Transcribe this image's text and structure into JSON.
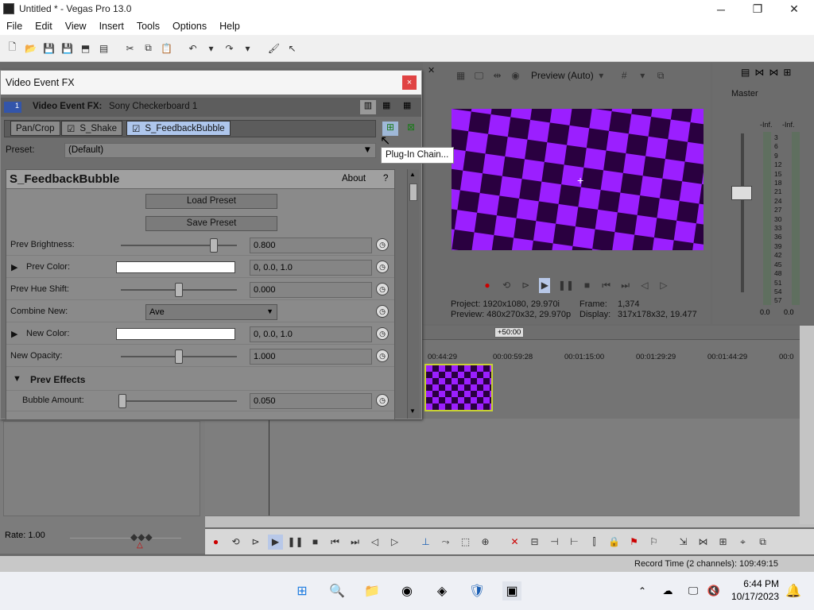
{
  "window": {
    "title": "Untitled * - Vegas Pro 13.0",
    "min": "─",
    "max": "❐",
    "close": "✕"
  },
  "menu": [
    "File",
    "Edit",
    "View",
    "Insert",
    "Tools",
    "Options",
    "Help"
  ],
  "fx": {
    "window_title": "Video Event FX",
    "close": "×",
    "header_label": "Video Event FX:",
    "header_value": "Sony Checkerboard 1",
    "track_no": "1",
    "chain": [
      "Pan/Crop",
      "S_Shake",
      "S_FeedbackBubble"
    ],
    "preset_label": "Preset:",
    "preset_value": "(Default)",
    "plugin_name": "S_FeedbackBubble",
    "about": "About",
    "help": "?",
    "load_preset": "Load Preset",
    "save_preset": "Save Preset",
    "params": [
      {
        "label": "Prev Brightness:",
        "value": "0.800",
        "slider": 0.85
      },
      {
        "label": "Prev Color:",
        "value": "0, 0.0, 1.0",
        "color": "#ffffff"
      },
      {
        "label": "Prev Hue Shift:",
        "value": "0.000",
        "slider": 0.5
      },
      {
        "label": "Combine New:",
        "value": "Ave"
      },
      {
        "label": "New Color:",
        "value": "0, 0.0, 1.0",
        "color": "#ffffff"
      },
      {
        "label": "New Opacity:",
        "value": "1.000",
        "slider": 0.5
      },
      {
        "label": "Prev Effects"
      },
      {
        "label": "Bubble Amount:",
        "value": "0.050",
        "slider": 0.02
      }
    ]
  },
  "tooltip": "Plug-In Chain...",
  "preview": {
    "mode": "Preview (Auto)",
    "project_label": "Project:",
    "project_value": "1920x1080, 29.970i",
    "preview_label": "Preview:",
    "preview_value": "480x270x32, 29.970p",
    "frame_label": "Frame:",
    "frame_value": "1,374",
    "display_label": "Display:",
    "display_value": "317x178x32, 19.477"
  },
  "master": {
    "title": "Master",
    "left_level": "-Inf.",
    "right_level": "-Inf.",
    "scale": [
      "3",
      "6",
      "9",
      "12",
      "15",
      "18",
      "21",
      "24",
      "27",
      "30",
      "33",
      "36",
      "39",
      "42",
      "45",
      "48",
      "51",
      "54",
      "57"
    ],
    "bottom_left": "0.0",
    "bottom_right": "0.0"
  },
  "timeline": {
    "offset": "+50:00",
    "timecodes": [
      "00:44:29",
      "00:00:59:28",
      "00:01:15:00",
      "00:01:29:29",
      "00:01:44:29",
      "00:0"
    ],
    "rate": "Rate: 1.00"
  },
  "status": {
    "record_time": "Record Time (2 channels): 109:49:15"
  },
  "taskbar": {
    "time": "6:44 PM",
    "date": "10/17/2023"
  },
  "colors": {
    "purple": "#9b1fff",
    "dark": "#2a0040",
    "clip_border": "#c9d233"
  }
}
